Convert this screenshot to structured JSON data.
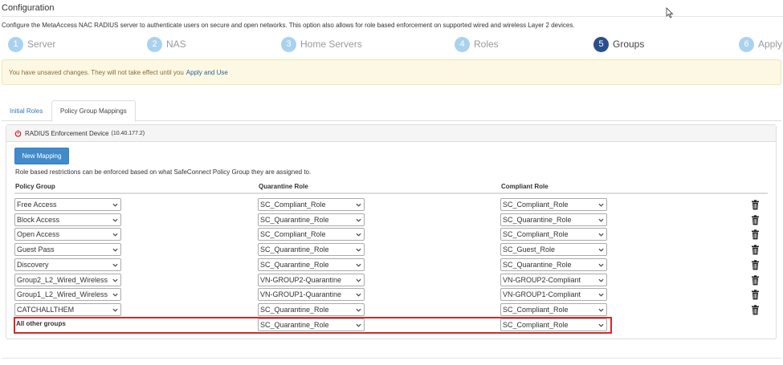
{
  "page": {
    "title": "Configuration",
    "description": "Configure the MetaAccess NAC RADIUS server to authenticate users on secure and open networks. This option also allows for role based enforcement on supported wired and wireless Layer 2 devices."
  },
  "wizard": {
    "steps": [
      {
        "num": "1",
        "label": "Server"
      },
      {
        "num": "2",
        "label": "NAS"
      },
      {
        "num": "3",
        "label": "Home Servers"
      },
      {
        "num": "4",
        "label": "Roles"
      },
      {
        "num": "5",
        "label": "Groups",
        "active": true
      },
      {
        "num": "6",
        "label": "Apply"
      }
    ]
  },
  "alert": {
    "text": "You have unsaved changes. They will not take effect until you",
    "link": "Apply and Use"
  },
  "tabs": {
    "initial_roles": "Initial Roles",
    "policy_group_mappings": "Policy Group Mappings"
  },
  "panel": {
    "heading": "RADIUS Enforcement Device",
    "ip": "(10.40.177.2)",
    "new_mapping": "New Mapping",
    "hint": "Role based restrictions can be enforced based on what SafeConnect Policy Group they are assigned to.",
    "columns": {
      "policy_group": "Policy Group",
      "quarantine_role": "Quarantine Role",
      "compliant_role": "Compliant Role"
    },
    "rows": [
      {
        "group": "Free Access",
        "quarantine": "SC_Compliant_Role",
        "compliant": "SC_Compliant_Role"
      },
      {
        "group": "Block Access",
        "quarantine": "SC_Quarantine_Role",
        "compliant": "SC_Quarantine_Role"
      },
      {
        "group": "Open Access",
        "quarantine": "SC_Compliant_Role",
        "compliant": "SC_Compliant_Role"
      },
      {
        "group": "Guest Pass",
        "quarantine": "SC_Quarantine_Role",
        "compliant": "SC_Guest_Role"
      },
      {
        "group": "Discovery",
        "quarantine": "SC_Quarantine_Role",
        "compliant": "SC_Quarantine_Role"
      },
      {
        "group": "Group2_L2_Wired_Wireless",
        "quarantine": "VN-GROUP2-Quarantine",
        "compliant": "VN-GROUP2-Compliant"
      },
      {
        "group": "Group1_L2_Wired_Wireless",
        "quarantine": "VN-GROUP1-Quarantine",
        "compliant": "VN-GROUP1-Compliant"
      },
      {
        "group": "CATCHALLTHEM",
        "quarantine": "SC_Quarantine_Role",
        "compliant": "SC_Compliant_Role"
      }
    ],
    "other_row": {
      "label": "All other groups",
      "quarantine": "SC_Quarantine_Role",
      "compliant": "SC_Compliant_Role"
    }
  },
  "colors": {
    "primary": "#428bca",
    "active_step": "#2b4f8c",
    "inactive_step": "#a9d2ef",
    "warning_bg": "#fcf8e3",
    "highlight": "#d9262a",
    "power_icon": "#d9262a"
  }
}
